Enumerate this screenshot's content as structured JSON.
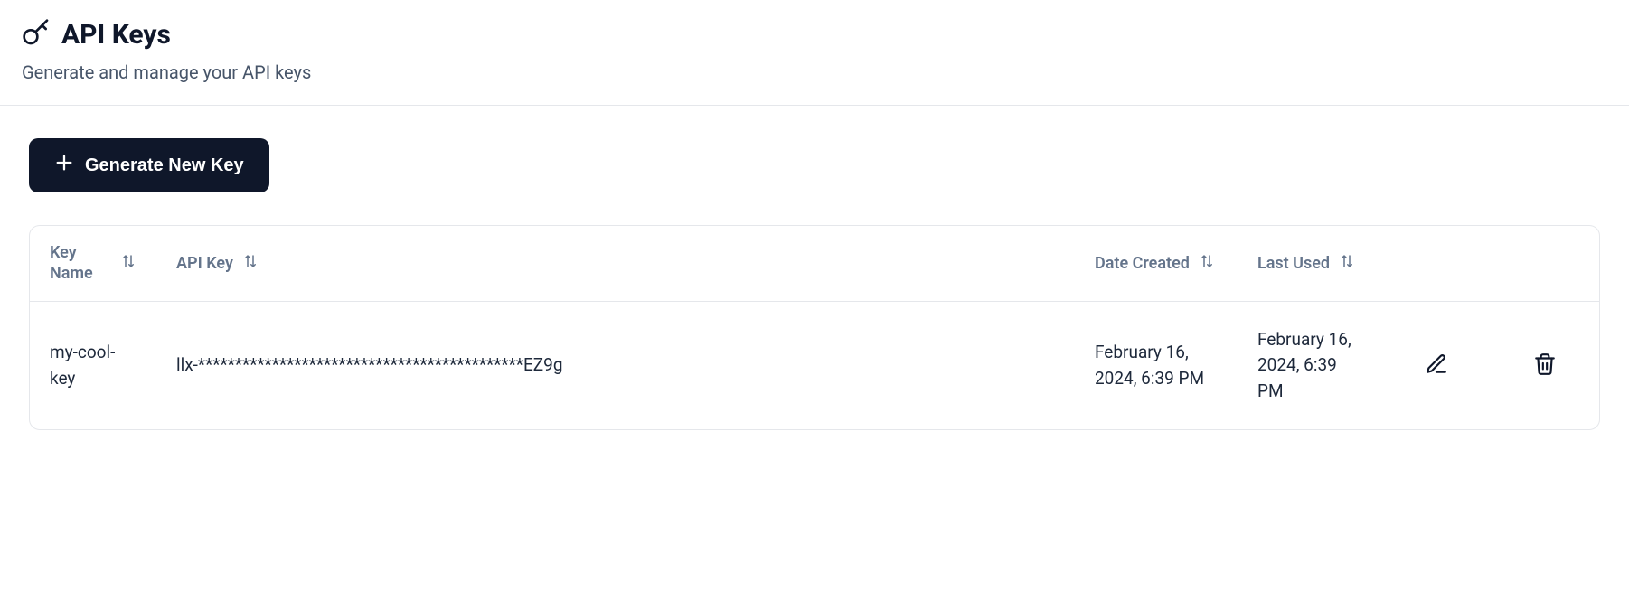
{
  "header": {
    "title": "API Keys",
    "subtitle": "Generate and manage your API keys"
  },
  "actions": {
    "generate_label": "Generate New Key"
  },
  "table": {
    "columns": {
      "key_name": "Key Name",
      "api_key": "API Key",
      "date_created": "Date Created",
      "last_used": "Last Used"
    },
    "rows": [
      {
        "key_name": "my-cool-key",
        "api_key": "llx-********************************************EZ9g",
        "date_created": "February 16, 2024, 6:39 PM",
        "last_used": "February 16, 2024, 6:39 PM"
      }
    ]
  }
}
